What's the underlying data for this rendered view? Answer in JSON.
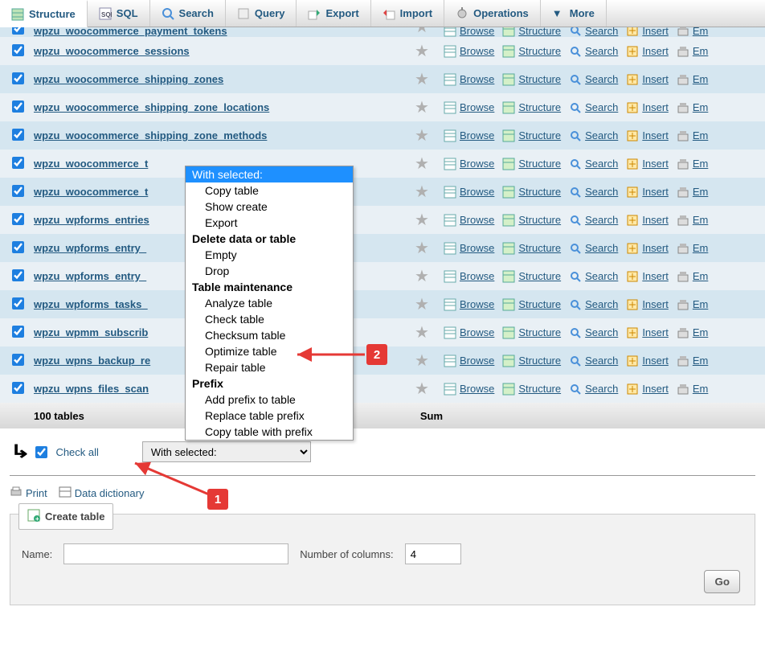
{
  "tabs": [
    {
      "label": "Structure"
    },
    {
      "label": "SQL"
    },
    {
      "label": "Search"
    },
    {
      "label": "Query"
    },
    {
      "label": "Export"
    },
    {
      "label": "Import"
    },
    {
      "label": "Operations"
    },
    {
      "label": "More"
    }
  ],
  "rows": [
    {
      "name": "wpzu_woocommerce_payment_tokens"
    },
    {
      "name": "wpzu_woocommerce_sessions"
    },
    {
      "name": "wpzu_woocommerce_shipping_zones"
    },
    {
      "name": "wpzu_woocommerce_shipping_zone_locations"
    },
    {
      "name": "wpzu_woocommerce_shipping_zone_methods"
    },
    {
      "name": "wpzu_woocommerce_t"
    },
    {
      "name": "wpzu_woocommerce_t"
    },
    {
      "name": "wpzu_wpforms_entries"
    },
    {
      "name": "wpzu_wpforms_entry_"
    },
    {
      "name": "wpzu_wpforms_entry_"
    },
    {
      "name": "wpzu_wpforms_tasks_"
    },
    {
      "name": "wpzu_wpmm_subscrib"
    },
    {
      "name": "wpzu_wpns_backup_re"
    },
    {
      "name": "wpzu_wpns_files_scan"
    }
  ],
  "row_actions": {
    "browse": "Browse",
    "structure": "Structure",
    "search": "Search",
    "insert": "Insert",
    "empty": "Em"
  },
  "footer": {
    "count": "100 tables",
    "sum": "Sum"
  },
  "checkall": {
    "label": "Check all",
    "select_placeholder": "With selected:"
  },
  "dropdown": {
    "items": [
      {
        "label": "With selected:",
        "type": "selected"
      },
      {
        "label": "Copy table",
        "type": "sub"
      },
      {
        "label": "Show create",
        "type": "sub"
      },
      {
        "label": "Export",
        "type": "sub"
      },
      {
        "label": "Delete data or table",
        "type": "header"
      },
      {
        "label": "Empty",
        "type": "sub"
      },
      {
        "label": "Drop",
        "type": "sub"
      },
      {
        "label": "Table maintenance",
        "type": "header"
      },
      {
        "label": "Analyze table",
        "type": "sub"
      },
      {
        "label": "Check table",
        "type": "sub"
      },
      {
        "label": "Checksum table",
        "type": "sub"
      },
      {
        "label": "Optimize table",
        "type": "sub"
      },
      {
        "label": "Repair table",
        "type": "sub"
      },
      {
        "label": "Prefix",
        "type": "header"
      },
      {
        "label": "Add prefix to table",
        "type": "sub"
      },
      {
        "label": "Replace table prefix",
        "type": "sub"
      },
      {
        "label": "Copy table with prefix",
        "type": "sub"
      }
    ]
  },
  "links": {
    "print": "Print",
    "dictionary": "Data dictionary"
  },
  "create": {
    "title": "Create table",
    "name_label": "Name:",
    "cols_label": "Number of columns:",
    "cols_value": "4",
    "go": "Go"
  },
  "annotations": {
    "b1": "1",
    "b2": "2"
  }
}
